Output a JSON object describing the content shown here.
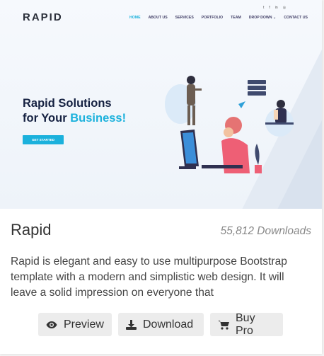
{
  "preview": {
    "logo": "RAPID",
    "nav": [
      "HOME",
      "ABOUT US",
      "SERVICES",
      "PORTFOLIO",
      "TEAM",
      "DROP DOWN ⌄",
      "CONTACT US"
    ],
    "social_icons": [
      "twitter-icon",
      "facebook-icon",
      "linkedin-icon",
      "instagram-icon"
    ],
    "social_glyphs": [
      "t",
      "f",
      "in",
      "◎"
    ],
    "headline_line1": "Rapid Solutions",
    "headline_line2_prefix": "for Your ",
    "headline_accent": "Business!",
    "cta_label": "GET STARTED",
    "accent_color": "#1bb1dc"
  },
  "card": {
    "title": "Rapid",
    "downloads": "55,812 Downloads",
    "description": "Rapid is elegant and easy to use multipurpose Bootstrap template with a modern and simplistic web design. It will leave a solid impression on everyone that"
  },
  "buttons": {
    "preview": "Preview",
    "download": "Download",
    "buy_pro": "Buy Pro"
  },
  "icons": {
    "preview": "eye-icon",
    "download": "download-icon",
    "buy_pro": "cart-icon"
  }
}
